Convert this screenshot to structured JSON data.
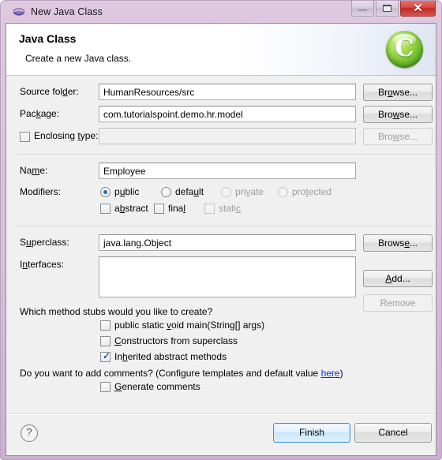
{
  "window": {
    "title": "New Java Class",
    "icon": "eclipse-icon",
    "controls": {
      "minimize": "minimize-icon",
      "maximize": "maximize-icon",
      "close": "close-icon"
    }
  },
  "banner": {
    "title": "Java Class",
    "subtitle": "Create a new Java class.",
    "logo_letter": "C"
  },
  "form": {
    "source_folder": {
      "label": "Source folder:",
      "label_pre": "Source fol",
      "label_mn": "d",
      "label_post": "er:",
      "value": "HumanResources/src",
      "browse_label": "Browse...",
      "browse_pre": "Br",
      "browse_mn": "o",
      "browse_post": "wse..."
    },
    "package": {
      "label": "Package:",
      "label_pre": "Pac",
      "label_mn": "k",
      "label_post": "age:",
      "value": "com.tutorialspoint.demo.hr.model",
      "browse_label": "Browse...",
      "browse_pre": "Bro",
      "browse_mn": "w",
      "browse_post": "se..."
    },
    "enclosing_type": {
      "label": "Enclosing type:",
      "label_pre": "Enclosing ",
      "label_mn": "t",
      "label_post": "ype:",
      "checked": false,
      "value": "",
      "browse_label": "Browse...",
      "browse_pre": "Bro",
      "browse_mn": "w",
      "browse_post": "se...",
      "disabled": true
    },
    "name": {
      "label": "Name:",
      "label_pre": "Na",
      "label_mn": "m",
      "label_post": "e:",
      "value": "Employee"
    },
    "modifiers": {
      "label": "Modifiers:",
      "radios": [
        {
          "label": "public",
          "pre": "p",
          "mn": "u",
          "post": "blic",
          "selected": true,
          "disabled": false
        },
        {
          "label": "default",
          "pre": "defa",
          "mn": "u",
          "post": "lt",
          "selected": false,
          "disabled": false
        },
        {
          "label": "private",
          "pre": "pri",
          "mn": "v",
          "post": "ate",
          "selected": false,
          "disabled": true
        },
        {
          "label": "protected",
          "pre": "pro",
          "mn": "t",
          "post": "ected",
          "selected": false,
          "disabled": true
        }
      ],
      "checkboxes": [
        {
          "label": "abstract",
          "pre": "a",
          "mn": "b",
          "post": "stract",
          "checked": false,
          "disabled": false
        },
        {
          "label": "final",
          "pre": "fina",
          "mn": "l",
          "post": "",
          "checked": false,
          "disabled": false
        },
        {
          "label": "static",
          "pre": "stati",
          "mn": "c",
          "post": "",
          "checked": false,
          "disabled": true
        }
      ]
    },
    "superclass": {
      "label": "Superclass:",
      "label_pre": "S",
      "label_mn": "u",
      "label_post": "perclass:",
      "value": "java.lang.Object",
      "browse_label": "Browse...",
      "browse_pre": "Brows",
      "browse_mn": "e",
      "browse_post": "..."
    },
    "interfaces": {
      "label": "Interfaces:",
      "label_pre": "I",
      "label_mn": "n",
      "label_post": "terfaces:",
      "items": [],
      "add_label": "Add...",
      "add_pre": "",
      "add_mn": "A",
      "add_post": "dd...",
      "remove_label": "Remove"
    },
    "method_stubs": {
      "question": "Which method stubs would you like to create?",
      "options": [
        {
          "label": "public static void main(String[] args)",
          "pre": "public static ",
          "mn": "v",
          "post": "oid main(String[] args)",
          "checked": false
        },
        {
          "label": "Constructors from superclass",
          "pre": "",
          "mn": "C",
          "post": "onstructors from superclass",
          "checked": false
        },
        {
          "label": "Inherited abstract methods",
          "pre": "In",
          "mn": "h",
          "post": "erited abstract methods",
          "checked": true
        }
      ]
    },
    "comments": {
      "question_pre": "Do you want to add comments? (Configure templates and default value ",
      "link": "here",
      "question_post": ")",
      "option": {
        "label": "Generate comments",
        "pre": "",
        "mn": "G",
        "post": "enerate comments",
        "checked": false
      }
    }
  },
  "footer": {
    "help": "?",
    "finish": "Finish",
    "cancel": "Cancel"
  }
}
